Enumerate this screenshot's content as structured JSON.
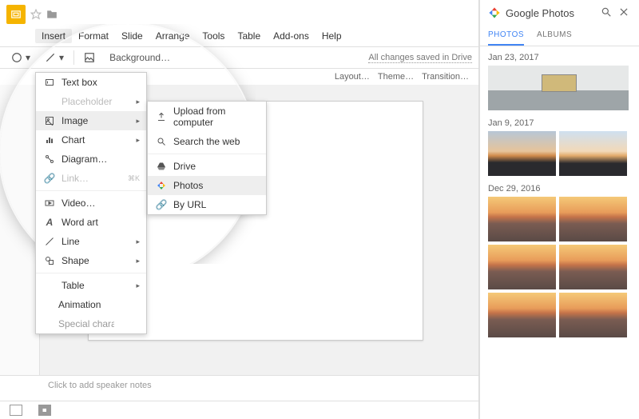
{
  "menubar": [
    "Insert",
    "Format",
    "Slide",
    "Arrange",
    "Tools",
    "Table",
    "Add-ons",
    "Help"
  ],
  "menubar_active_index": 0,
  "saved_label": "All changes saved in Drive",
  "toolbar": {
    "background": "Background…",
    "layout": "Layout…",
    "theme": "Theme…",
    "transition": "Transition…"
  },
  "insert_menu": {
    "text_box": "Text box",
    "placeholder": "Placeholder",
    "image": "Image",
    "chart": "Chart",
    "diagram": "Diagram…",
    "link": "Link…",
    "link_shortcut": "⌘K",
    "video": "Video…",
    "word_art": "Word art",
    "line": "Line",
    "shape": "Shape",
    "table": "Table",
    "animation": "Animation",
    "special": "Special characters…"
  },
  "image_submenu": {
    "upload": "Upload from computer",
    "search": "Search the web",
    "drive": "Drive",
    "photos": "Photos",
    "by_url": "By URL"
  },
  "notes_placeholder": "Click to add speaker notes",
  "right_panel": {
    "title": "Google Photos",
    "tabs": {
      "photos": "PHOTOS",
      "albums": "ALBUMS"
    },
    "groups": [
      {
        "date": "Jan 23, 2017",
        "thumbs": [
          {
            "cls": "bg-building",
            "full": true
          }
        ]
      },
      {
        "date": "Jan 9, 2017",
        "thumbs": [
          {
            "cls": "bg-sunset1"
          },
          {
            "cls": "bg-sunset2"
          }
        ]
      },
      {
        "date": "Dec 29, 2016",
        "thumbs": [
          {
            "cls": "bg-city"
          },
          {
            "cls": "bg-city"
          },
          {
            "cls": "bg-city"
          },
          {
            "cls": "bg-city"
          },
          {
            "cls": "bg-city"
          },
          {
            "cls": "bg-city"
          }
        ]
      }
    ]
  }
}
